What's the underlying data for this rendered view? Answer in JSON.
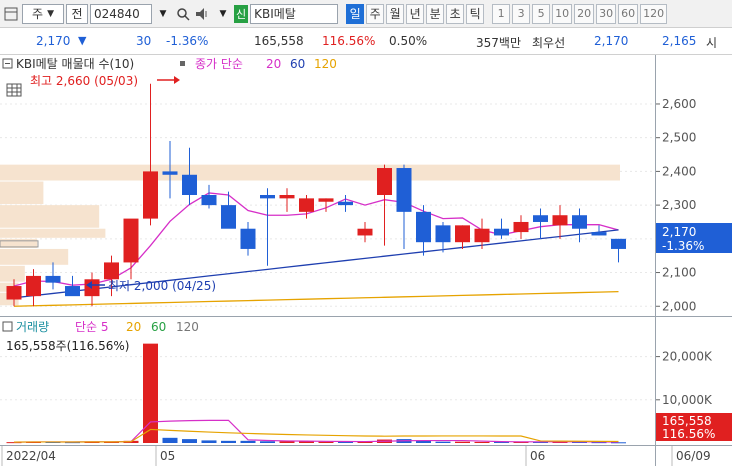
{
  "toolbar": {
    "market_label": "주",
    "prefix_label": "전",
    "code": "024840",
    "exchange_badge": "신",
    "stock_name": "KBI메탈",
    "period_buttons": [
      "일",
      "주",
      "월",
      "년",
      "분",
      "초",
      "틱"
    ],
    "active_period": "일",
    "interval_buttons": [
      "1",
      "3",
      "5",
      "10",
      "20",
      "30",
      "60",
      "120"
    ]
  },
  "quote": {
    "price": "2,170",
    "change": "30",
    "change_pct": "-1.36%",
    "volume": "165,558",
    "volume_ratio": "116.56%",
    "rate": "0.50%",
    "amount": "357백만",
    "best_ask_label": "최우선",
    "ask": "2,170",
    "bid": "2,165",
    "tail": "시"
  },
  "price_panel": {
    "title": "KBI메탈 매물대 수(10)",
    "ma_label": "종가 단순",
    "ma_periods": [
      "20",
      "60",
      "120"
    ],
    "high_label": "최고 2,660 (05/03)",
    "low_label": "최저 2,000 (04/25)",
    "y_ticks": [
      "2,600",
      "2,500",
      "2,400",
      "2,300",
      "2,200",
      "2,100",
      "2,000"
    ],
    "last_price_tag": "2,170",
    "last_change_tag": "-1.36%"
  },
  "volume_panel": {
    "title": "거래량",
    "ma_label": "단순 5",
    "ma_periods": [
      "20",
      "60",
      "120"
    ],
    "readout": "165,558주(116.56%)",
    "y_ticks": [
      "20,000K",
      "10,000K"
    ],
    "last_volume_tag": "165,558",
    "last_ratio_tag": "116.56%"
  },
  "x_axis": {
    "labels": [
      "2022/04",
      "05",
      "06",
      "06/09"
    ]
  },
  "colors": {
    "up": "#e02020",
    "down": "#1f5fd6",
    "ma5": "#d62fc8",
    "ma20": "#d62fc8",
    "ma60": "#1f3fb0",
    "ma120": "#e6a300",
    "profile": "#f6e3cf"
  },
  "chart_data": {
    "type": "candlestick",
    "x": [
      "04/22",
      "04/25",
      "04/26",
      "04/27",
      "04/28",
      "04/29",
      "05/02",
      "05/03",
      "05/04",
      "05/06",
      "05/09",
      "05/10",
      "05/11",
      "05/12",
      "05/13",
      "05/16",
      "05/17",
      "05/18",
      "05/19",
      "05/20",
      "05/23",
      "05/24",
      "05/25",
      "05/26",
      "05/27",
      "05/30",
      "05/31",
      "06/02",
      "06/03",
      "06/07",
      "06/08",
      "06/09"
    ],
    "open": [
      2020,
      2030,
      2090,
      2060,
      2030,
      2080,
      2130,
      2260,
      2400,
      2390,
      2330,
      2300,
      2230,
      2330,
      2320,
      2280,
      2310,
      2310,
      2210,
      2330,
      2410,
      2280,
      2240,
      2190,
      2190,
      2230,
      2220,
      2270,
      2240,
      2270,
      2220,
      2200
    ],
    "high": [
      2080,
      2110,
      2130,
      2090,
      2100,
      2150,
      2190,
      2660,
      2490,
      2470,
      2360,
      2340,
      2250,
      2350,
      2350,
      2330,
      2320,
      2330,
      2250,
      2420,
      2420,
      2300,
      2250,
      2240,
      2260,
      2260,
      2270,
      2290,
      2300,
      2290,
      2240,
      2200
    ],
    "low": [
      2000,
      2000,
      2050,
      2040,
      2000,
      2030,
      2080,
      2240,
      2320,
      2300,
      2290,
      2270,
      2150,
      2120,
      2280,
      2260,
      2280,
      2280,
      2190,
      2180,
      2170,
      2150,
      2160,
      2170,
      2170,
      2200,
      2200,
      2200,
      2200,
      2190,
      2210,
      2130
    ],
    "close": [
      2060,
      2090,
      2070,
      2030,
      2080,
      2130,
      2260,
      2400,
      2390,
      2330,
      2300,
      2230,
      2170,
      2320,
      2330,
      2320,
      2320,
      2300,
      2230,
      2410,
      2280,
      2190,
      2190,
      2240,
      2230,
      2210,
      2250,
      2250,
      2270,
      2230,
      2210,
      2170
    ],
    "ylim": [
      1980,
      2680
    ],
    "volume": [
      200,
      300,
      250,
      200,
      350,
      300,
      500,
      23000,
      1200,
      900,
      600,
      500,
      500,
      400,
      400,
      350,
      300,
      300,
      300,
      800,
      900,
      500,
      300,
      300,
      250,
      250,
      300,
      300,
      250,
      250,
      200,
      165.558
    ],
    "volume_unit": "K",
    "volume_ylim": [
      0,
      25000
    ],
    "volume_profile": [
      {
        "low": 2370,
        "high": 2420,
        "relative": 1.0
      },
      {
        "low": 2300,
        "high": 2370,
        "relative": 0.07
      },
      {
        "low": 2230,
        "high": 2300,
        "relative": 0.16
      },
      {
        "low": 2200,
        "high": 2230,
        "relative": 0.17
      },
      {
        "low": 2170,
        "high": 2200,
        "relative": 0.06
      },
      {
        "low": 2120,
        "high": 2170,
        "relative": 0.11
      },
      {
        "low": 2070,
        "high": 2120,
        "relative": 0.04
      },
      {
        "low": 2040,
        "high": 2070,
        "relative": 0.03
      },
      {
        "low": 2000,
        "high": 2040,
        "relative": 0.03
      }
    ]
  }
}
